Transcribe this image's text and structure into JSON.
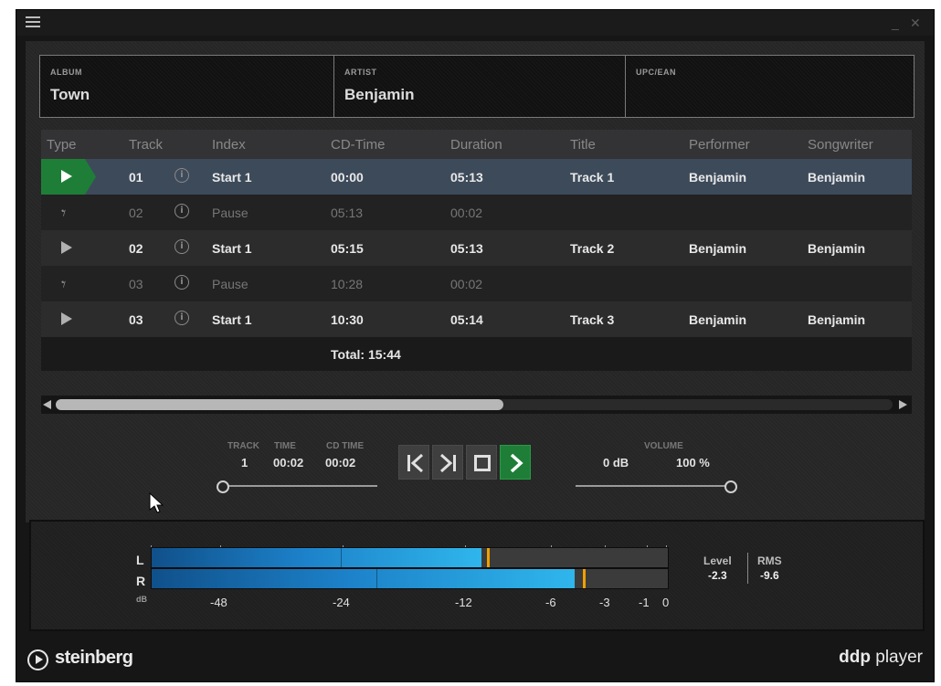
{
  "titlebar": {
    "menu_icon": "hamburger-icon",
    "minimize_glyph": "_",
    "close_glyph": "✕"
  },
  "info": {
    "album_label": "ALBUM",
    "album_value": "Town",
    "artist_label": "ARTIST",
    "artist_value": "Benjamin",
    "upc_label": "UPC/EAN",
    "upc_value": ""
  },
  "tracklist": {
    "columns": [
      "Type",
      "Track",
      "Index",
      "CD-Time",
      "Duration",
      "Title",
      "Performer",
      "Songwriter"
    ],
    "rows": [
      {
        "type": "play-icon",
        "track": "01",
        "index": "Start 1",
        "cd_time": "00:00",
        "duration": "05:13",
        "title": "Track 1",
        "performer": "Benjamin",
        "songwriter": "Benjamin"
      },
      {
        "type": "pause-icon",
        "track": "02",
        "index": "Pause",
        "cd_time": "05:13",
        "duration": "00:02",
        "title": "",
        "performer": "",
        "songwriter": ""
      },
      {
        "type": "play-icon",
        "track": "02",
        "index": "Start 1",
        "cd_time": "05:15",
        "duration": "05:13",
        "title": "Track 2",
        "performer": "Benjamin",
        "songwriter": "Benjamin"
      },
      {
        "type": "pause-icon",
        "track": "03",
        "index": "Pause",
        "cd_time": "10:28",
        "duration": "00:02",
        "title": "",
        "performer": "",
        "songwriter": ""
      },
      {
        "type": "play-icon",
        "track": "03",
        "index": "Start 1",
        "cd_time": "10:30",
        "duration": "05:14",
        "title": "Track 3",
        "performer": "Benjamin",
        "songwriter": "Benjamin"
      }
    ],
    "total": "Total: 15:44"
  },
  "transport": {
    "track_label": "TRACK",
    "track_value": "1",
    "time_label": "TIME",
    "time_value": "00:02",
    "cdtime_label": "CD TIME",
    "cdtime_value": "00:02",
    "volume_label": "VOLUME",
    "volume_db": "0 dB",
    "volume_percent": "100 %",
    "position_fraction": 0.0,
    "volume_fraction": 1.0
  },
  "meter": {
    "left_label": "L",
    "right_label": "R",
    "unit": "dB",
    "scale": [
      "-48",
      "-24",
      "-12",
      "-6",
      "-3",
      "-1",
      "0"
    ],
    "level_label": "Level",
    "level_value": "-2.3",
    "rms_label": "RMS",
    "rms_value": "-9.6"
  },
  "footer": {
    "brand": "steinberg",
    "product_bold": "ddp",
    "product_light": " player"
  },
  "colors": {
    "accent_green": "#1e7e37",
    "selected_row": "#3d4a5a",
    "meter_blue": "#2fb6ec",
    "peak_orange": "#f0a000"
  }
}
